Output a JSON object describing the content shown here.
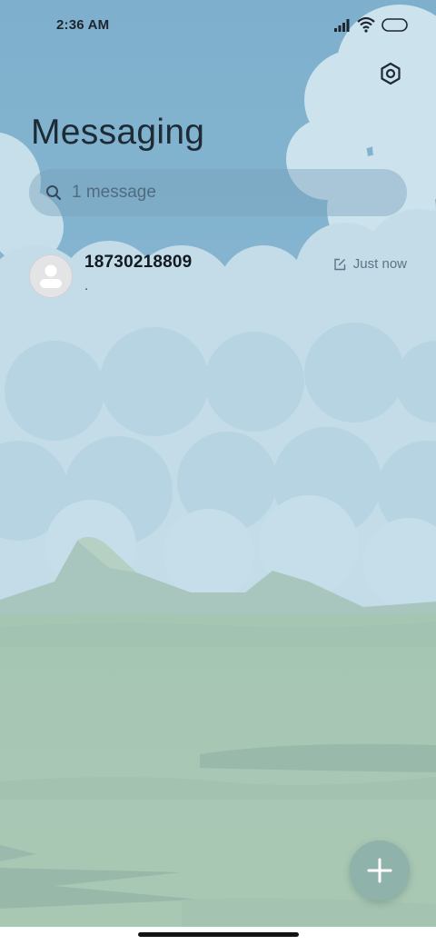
{
  "status_bar": {
    "time": "2:36 AM",
    "icons": [
      "signal-icon",
      "wifi-icon",
      "battery-icon"
    ]
  },
  "header": {
    "title": "Messaging",
    "settings_icon": "gear-icon"
  },
  "search": {
    "placeholder": "1 message",
    "value": ""
  },
  "conversations": [
    {
      "name": "18730218809",
      "preview": ".",
      "time": "Just now",
      "status_icon": "draft-icon",
      "avatar_icon": "person-icon"
    }
  ],
  "fab": {
    "icon": "plus-icon"
  },
  "colors": {
    "sky": "#7fb1cd",
    "cloud": "#cfe3ec",
    "mountain": "#a9c7bd",
    "grass": "#9fc0ad",
    "fab": "#8fb2ab",
    "title_text": "#1e2a36"
  }
}
